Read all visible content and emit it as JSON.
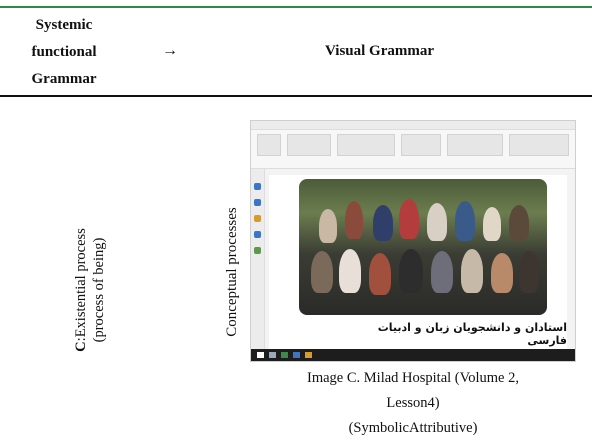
{
  "header": {
    "left_lines": [
      "Systemic",
      "functional",
      "Grammar"
    ],
    "arrow": "→",
    "right_title": "Visual Grammar"
  },
  "row": {
    "left_label_bold": "C",
    "left_label_rest": ":Existential process",
    "left_label_line2": "(process of being)",
    "mid_label": "Conceptual processes",
    "screenshot_caption_fa": "استادان و دانشجویان زبان و ادبیات فارسی",
    "caption_lines": [
      "Image C. Milad Hospital (Volume 2,",
      "Lesson4)",
      "(SymbolicAttributive)"
    ]
  },
  "colors": {
    "top_rule": "#2d8a46",
    "rule": "#111111"
  }
}
